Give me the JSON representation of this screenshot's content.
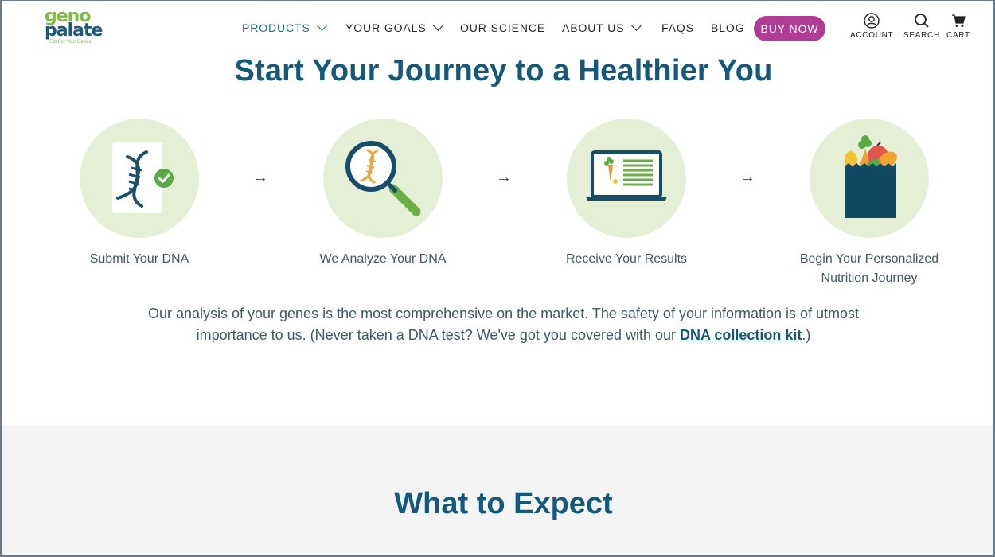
{
  "brand": {
    "logo_top": "geno",
    "logo_bottom": "palate",
    "tagline": "Eat For Your Genes"
  },
  "nav": {
    "items": [
      {
        "label": "PRODUCTS",
        "has_dropdown": true,
        "active": true
      },
      {
        "label": "YOUR GOALS",
        "has_dropdown": true
      },
      {
        "label": "OUR SCIENCE",
        "has_dropdown": false
      },
      {
        "label": "ABOUT US",
        "has_dropdown": true
      },
      {
        "label": "FAQS",
        "has_dropdown": false
      },
      {
        "label": "BLOG",
        "has_dropdown": false
      }
    ],
    "buy_now": "BUY NOW",
    "account": {
      "label": "ACCOUNT",
      "icon": "user-circle-icon"
    },
    "search": {
      "label": "SEARCH",
      "icon": "search-icon"
    },
    "cart": {
      "label": "CART",
      "icon": "cart-icon"
    }
  },
  "hero": {
    "title": "Start Your Journey to a Healthier You",
    "steps": [
      {
        "caption": "Submit Your DNA",
        "icon": "dna-document-check-icon"
      },
      {
        "caption": "We Analyze Your DNA",
        "icon": "magnifier-dna-icon"
      },
      {
        "caption": "Receive Your Results",
        "icon": "laptop-results-icon"
      },
      {
        "caption": "Begin Your Personalized Nutrition Journey",
        "icon": "grocery-bag-icon"
      }
    ],
    "arrow": "→",
    "description_before": "Our analysis of your genes is the most comprehensive on the market. The safety of your information is of utmost importance to us. (Never taken a DNA test? We've got you covered with our ",
    "description_link": "DNA collection kit",
    "description_after": ".)"
  },
  "what_to_expect": {
    "title": "What to Expect"
  },
  "colors": {
    "brand_blue": "#14587a",
    "brand_green": "#7dbb42",
    "buy_now_magenta": "#b03c93",
    "circle_bg": "#e5efd6",
    "section_gray": "#f4f4f4"
  }
}
